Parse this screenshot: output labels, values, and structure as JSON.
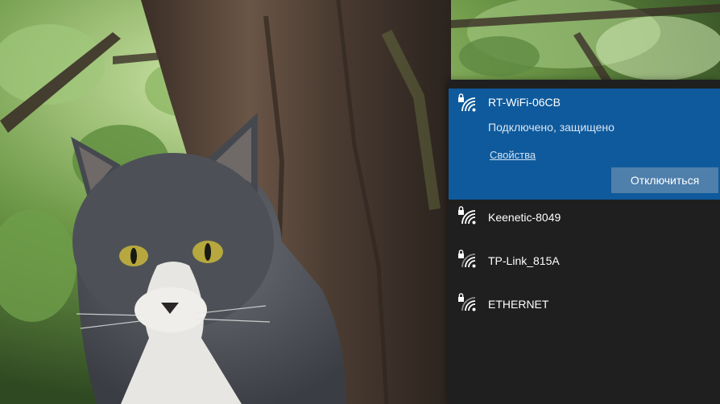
{
  "wifi_flyout": {
    "connected_network": {
      "name": "RT-WiFi-06CB",
      "status": "Подключено, защищено",
      "properties_link": "Свойства",
      "disconnect_button": "Отключиться",
      "icon": "wifi-secured-icon"
    },
    "networks": [
      {
        "name": "Keenetic-8049",
        "icon": "wifi-secured-icon"
      },
      {
        "name": "TP-Link_815A",
        "icon": "wifi-secured-icon"
      },
      {
        "name": "ETHERNET",
        "icon": "wifi-secured-icon"
      }
    ]
  },
  "colors": {
    "connected_bg": "#0f5a9c",
    "flyout_bg": "#1f1f1f",
    "button_bg": "#4f7fab",
    "link": "#cfe3f6"
  }
}
